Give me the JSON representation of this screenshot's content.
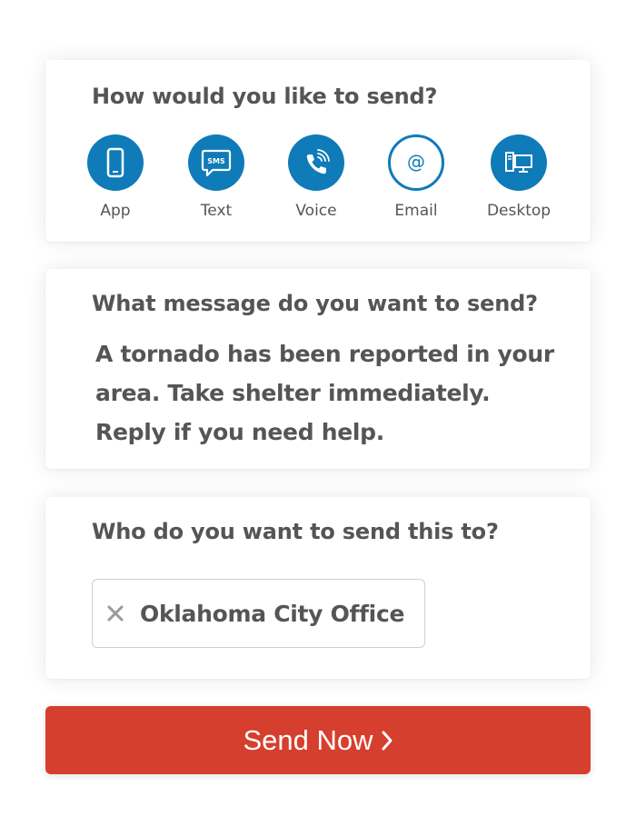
{
  "channels_card": {
    "title": "How would you like to send?",
    "channels": [
      {
        "label": "App",
        "icon": "smartphone-icon",
        "style": "filled"
      },
      {
        "label": "Text",
        "icon": "sms-bubble-icon",
        "icon_text": "SMS",
        "style": "filled"
      },
      {
        "label": "Voice",
        "icon": "phone-call-icon",
        "style": "filled"
      },
      {
        "label": "Email",
        "icon": "at-sign-icon",
        "icon_text": "@",
        "style": "outline"
      },
      {
        "label": "Desktop",
        "icon": "desktop-computer-icon",
        "style": "filled"
      }
    ]
  },
  "message_card": {
    "title": "What message do you want to send?",
    "message": "A tornado has been reported in your area. Take shelter immediately. Reply if you need help."
  },
  "recipients_card": {
    "title": "Who do you want to send this to?",
    "recipients": [
      {
        "label": "Oklahoma City Office"
      }
    ]
  },
  "send_button": {
    "label": "Send Now"
  },
  "colors": {
    "accent_blue": "#0f7bb8",
    "send_red": "#d63f2d",
    "text_gray": "#555555",
    "card_background": "#ffffff"
  }
}
